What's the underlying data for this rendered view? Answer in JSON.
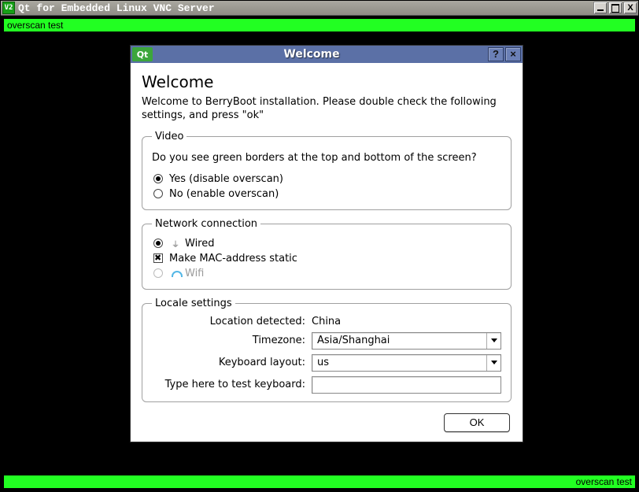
{
  "window": {
    "icon_text": "V2",
    "title": "Qt for Embedded Linux VNC Server"
  },
  "overscan": {
    "top_text": "overscan test",
    "bottom_text": "overscan test"
  },
  "dialog": {
    "title": "Welcome",
    "qt_text": "Qt",
    "help_label": "?",
    "close_label": "×",
    "heading": "Welcome",
    "intro": "Welcome to BerryBoot installation. Please double check the following settings, and press \"ok\"",
    "video": {
      "legend": "Video",
      "question": "Do you see green borders at the top and bottom of the screen?",
      "yes": "Yes  (disable overscan)",
      "no": "No   (enable overscan)",
      "selected": "yes"
    },
    "network": {
      "legend": "Network connection",
      "wired": "Wired",
      "mac": "Make MAC-address static",
      "wifi": "Wifi",
      "conn_selected": "wired",
      "mac_checked": true,
      "wifi_enabled": false
    },
    "locale": {
      "legend": "Locale settings",
      "location_label": "Location detected:",
      "location_value": "China",
      "timezone_label": "Timezone:",
      "timezone_value": "Asia/Shanghai",
      "keyboard_label": "Keyboard layout:",
      "keyboard_value": "us",
      "test_label": "Type here to test keyboard:",
      "test_value": ""
    },
    "ok_label": "OK"
  }
}
